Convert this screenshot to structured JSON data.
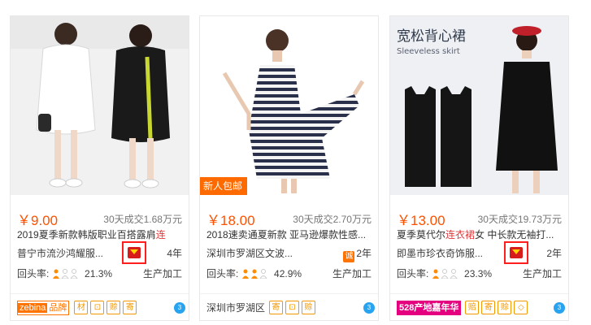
{
  "cards": [
    {
      "price": "￥9.00",
      "sold": "30天成交1.68万元",
      "title_a": "2019夏季新款韩版职业百搭露肩",
      "title_b": "连",
      "shop": "普宁市流沙鸿耀服...",
      "years": "4年",
      "rate_label": "回头率:",
      "rate": "21.3%",
      "prod": "生产加工",
      "brand_a": "zebina",
      "brand_b": "品牌",
      "icons": [
        "材",
        "⊡",
        "赊",
        "寄"
      ]
    },
    {
      "new_tag": "新人包邮",
      "price": "￥18.00",
      "sold": "30天成交2.70万元",
      "title_a": "2018速卖通夏新款 亚马逊爆款性感...",
      "title_b": "",
      "shop": "深圳市罗湖区文波...",
      "years": "2年",
      "cheng": "诚",
      "rate_label": "回头率:",
      "rate": "42.9%",
      "prod": "生产加工",
      "location": "深圳市罗湖区",
      "icons": [
        "寄",
        "⊡",
        "赊"
      ]
    },
    {
      "price": "￥13.00",
      "sold": "30天成交19.73万元",
      "title_a": "夏季莫代尔",
      "title_b": "连衣裙",
      "title_c": "女 中长款无袖打...",
      "shop": "即墨市珍衣奇饰服...",
      "years": "2年",
      "rate_label": "回头率:",
      "rate": "23.3%",
      "prod": "生产加工",
      "event": "528产地嘉年华",
      "icons": [
        "赔",
        "寄",
        "赊",
        "◇"
      ],
      "img_title": "宽松背心裙",
      "img_subtitle": "Sleeveless skirt"
    }
  ],
  "ww_label": "3"
}
